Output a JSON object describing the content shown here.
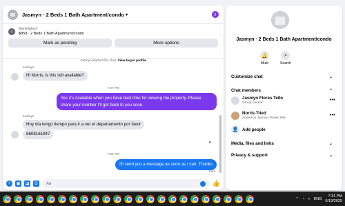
{
  "chat": {
    "title": "Jasmyn · 2 Beds 1 Bath Apartment/condo",
    "listing": {
      "category": "Marketplace",
      "price_title": "$850 · 2 Beds 1 Bath Apartment/condo",
      "buttons": [
        "Mark as pending",
        "More options"
      ]
    },
    "system_note_prefix": "Jasmyn started this chat.",
    "system_note_link": "View buyer profile",
    "messages": [
      {
        "sender": "Jasmyn",
        "text": "Hi Norris, is this still available?"
      },
      {
        "time": "7:07 PM"
      },
      {
        "text": "Yes it's Available when you have best time for viewing the property..Please share your number I'll get back to you soon."
      },
      {
        "sender": "Jasmyn",
        "text": "Hoy día tengo tiempo para ir a ver el departamento por favor"
      },
      {
        "text": "8608161947"
      },
      {
        "time": "7:31 PM"
      },
      {
        "text": "I'll send you a message as soon as I can. Thanks"
      },
      {
        "status": "Sent"
      }
    ],
    "composer_placeholder": "Aa"
  },
  "side": {
    "title": "Jasmyn · 2 Beds 1 Bath Apartment/condo",
    "actions": [
      "Mute",
      "Search"
    ],
    "sections": [
      "Customize chat",
      "Chat members",
      "Media, files and links",
      "Privacy & support"
    ],
    "members": [
      {
        "name": "Jasmyn Flores Tello",
        "sub": "Group creator"
      },
      {
        "name": "Norris Tried",
        "sub": "Added by Jasmyn Flores Tello"
      }
    ],
    "add_people": "Add people"
  },
  "taskbar": {
    "lang": "ENG",
    "time": "7:31 PM",
    "date": "6/19/2025"
  },
  "colors": {
    "accent": "#7b39ed",
    "blue": "#1977f2"
  }
}
